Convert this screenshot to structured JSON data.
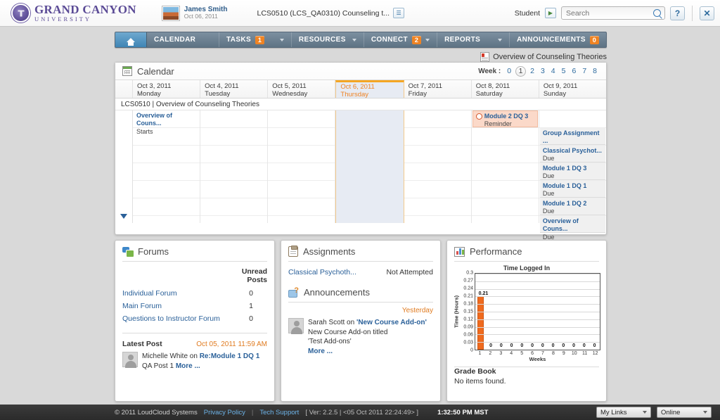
{
  "header": {
    "logo_line1": "GRAND CANYON",
    "logo_line2": "UNIVERSITY",
    "user_name": "James Smith",
    "user_date": "Oct 06, 2011",
    "course_selector": "LCS0510 (LCS_QA0310) Counseling t...",
    "course_selector_icon": "list-icon",
    "role_label": "Student",
    "role_switch_icon": "user-switch-icon",
    "search_placeholder": "Search",
    "search_value": "",
    "help_label": "?",
    "close_label": "✕"
  },
  "nav": {
    "home_icon": "home-icon",
    "items": [
      {
        "label": "CALENDAR",
        "badge": null,
        "caret": false
      },
      {
        "label": "TASKS",
        "badge": "1",
        "caret": true
      },
      {
        "label": "RESOURCES",
        "badge": null,
        "caret": true
      },
      {
        "label": "CONNECT",
        "badge": "2",
        "caret": true
      },
      {
        "label": "REPORTS",
        "badge": null,
        "caret": true
      },
      {
        "label": "ANNOUNCEMENTS",
        "badge": "0",
        "caret": false
      }
    ]
  },
  "breadcrumb": {
    "label": "Overview of Counseling Theories",
    "icon": "course-icon"
  },
  "calendar": {
    "title": "Calendar",
    "week_label": "Week :",
    "weeks": [
      "0",
      "1",
      "2",
      "3",
      "4",
      "5",
      "6",
      "7",
      "8"
    ],
    "active_week": "1",
    "course_row": "LCS0510 | Overview of Counseling Theories",
    "days": [
      {
        "date": "Oct 3, 2011",
        "day": "Monday",
        "today": false
      },
      {
        "date": "Oct 4, 2011",
        "day": "Tuesday",
        "today": false
      },
      {
        "date": "Oct 5, 2011",
        "day": "Wednesday",
        "today": false
      },
      {
        "date": "Oct 6, 2011",
        "day": "Thursday",
        "today": true
      },
      {
        "date": "Oct 7, 2011",
        "day": "Friday",
        "today": false
      },
      {
        "date": "Oct 8, 2011",
        "day": "Saturday",
        "today": false
      },
      {
        "date": "Oct 9, 2011",
        "day": "Sunday",
        "today": false
      }
    ],
    "events": {
      "monday": [
        {
          "title": "Overview of Couns...",
          "status": "Starts",
          "style": "plain"
        }
      ],
      "saturday": [
        {
          "title": "Module 2 DQ 3",
          "status": "Reminder",
          "style": "reminder",
          "icon": "alarm-clock-icon"
        }
      ],
      "sunday": [
        {
          "title": "Group Assignment ...",
          "status": "Due",
          "style": "normal"
        },
        {
          "title": "Classical Psychot...",
          "status": "Due",
          "style": "normal"
        },
        {
          "title": "Module 1 DQ 3",
          "status": "Due",
          "style": "normal"
        },
        {
          "title": "Module 1 DQ 1",
          "status": "Due",
          "style": "normal"
        },
        {
          "title": "Module 1 DQ 2",
          "status": "Due",
          "style": "normal"
        },
        {
          "title": "Overview of Couns...",
          "status": "Due",
          "style": "normal"
        }
      ]
    },
    "scroll_down_icon": "chevron-down-icon"
  },
  "forums": {
    "title": "Forums",
    "icon": "forums-icon",
    "column_header": "Unread Posts",
    "rows": [
      {
        "name": "Individual Forum",
        "unread": "0"
      },
      {
        "name": "Main Forum",
        "unread": "1"
      },
      {
        "name": "Questions to Instructor Forum",
        "unread": "0"
      }
    ],
    "latest_post_label": "Latest Post",
    "latest_post_date": "Oct 05, 2011 11:59 AM",
    "post_author": "Michelle White on",
    "post_subject": "Re:Module 1 DQ 1",
    "post_body": "QA Post 1",
    "post_more": "More ..."
  },
  "assignments": {
    "title": "Assignments",
    "icon": "assignments-icon",
    "rows": [
      {
        "name": "Classical Psychoth...",
        "status": "Not Attempted"
      }
    ]
  },
  "announcements": {
    "title": "Announcements",
    "icon": "announcements-icon",
    "date_label": "Yesterday",
    "author": "Sarah Scott on",
    "subject": "'New Course Add-on'",
    "body": "New Course Add-on titled 'Test Add-ons'",
    "more": "More ..."
  },
  "performance": {
    "title": "Performance",
    "icon": "performance-icon",
    "gradebook_title": "Grade Book",
    "gradebook_empty": "No items found."
  },
  "chart_data": {
    "type": "bar",
    "title": "Time Logged In",
    "xlabel": "Weeks",
    "ylabel": "Time (Hours)",
    "categories": [
      "1",
      "2",
      "3",
      "4",
      "5",
      "6",
      "7",
      "8",
      "9",
      "10",
      "11",
      "12"
    ],
    "values": [
      0.21,
      0,
      0,
      0,
      0,
      0,
      0,
      0,
      0,
      0,
      0,
      0
    ],
    "data_labels": [
      "0.21",
      "0",
      "0",
      "0",
      "0",
      "0",
      "0",
      "0",
      "0",
      "0",
      "0",
      "0"
    ],
    "ylim": [
      0,
      0.3
    ],
    "yticks": [
      "0",
      "0.03",
      "0.06",
      "0.09",
      "0.12",
      "0.15",
      "0.18",
      "0.21",
      "0.24",
      "0.27",
      "0.3"
    ],
    "grid": true,
    "legend": "none",
    "bar_color": "#ef6a1e"
  },
  "footer": {
    "copyright": "© 2011 LoudCloud Systems",
    "privacy": "Privacy Policy",
    "separator": "|",
    "support": "Tech Support",
    "version": "[ Ver: 2.2.5 | <05 Oct 2011 22:24:49> ]",
    "clock": "1:32:50 PM MST",
    "my_links": "My Links",
    "status": "Online"
  }
}
